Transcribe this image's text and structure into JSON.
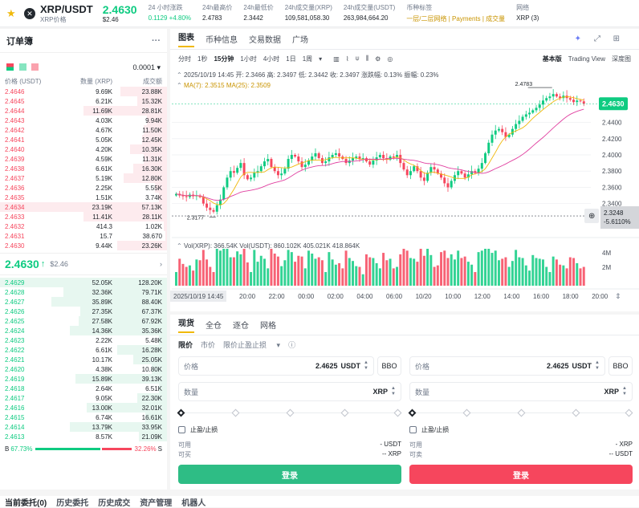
{
  "header": {
    "symbol": "XRP/USDT",
    "sub_label": "XRP价格",
    "price": "2.4630",
    "price_usd": "$2.46",
    "stats": [
      {
        "label": "24 小时涨跌",
        "value": "0.1129 +4.80%",
        "tone": "green"
      },
      {
        "label": "24h最高价",
        "value": "2.4783",
        "tone": ""
      },
      {
        "label": "24h最低价",
        "value": "2.3442",
        "tone": ""
      },
      {
        "label": "24h成交量(XRP)",
        "value": "109,581,058.30",
        "tone": ""
      },
      {
        "label": "24h成交量(USDT)",
        "value": "263,984,664.20",
        "tone": ""
      },
      {
        "label": "币种标签",
        "value": "一层/二层网络 | Payments | 成交量",
        "tone": "yellow"
      },
      {
        "label": "网络",
        "value": "XRP (3)",
        "tone": ""
      }
    ]
  },
  "orderbook": {
    "title": "订单簿",
    "tick": "0.0001",
    "columns": [
      "价格 (USDT)",
      "数量 (XRP)",
      "成交额"
    ],
    "asks": [
      {
        "price": "2.4646",
        "qty": "9.69K",
        "total": "23.88K",
        "depth": 0.28
      },
      {
        "price": "2.4645",
        "qty": "6.21K",
        "total": "15.32K",
        "depth": 0.18
      },
      {
        "price": "2.4644",
        "qty": "11.69K",
        "total": "28.81K",
        "depth": 0.5
      },
      {
        "price": "2.4643",
        "qty": "4.03K",
        "total": "9.94K",
        "depth": 0.12
      },
      {
        "price": "2.4642",
        "qty": "4.67K",
        "total": "11.50K",
        "depth": 0.14
      },
      {
        "price": "2.4641",
        "qty": "5.05K",
        "total": "12.45K",
        "depth": 0.15
      },
      {
        "price": "2.4640",
        "qty": "4.20K",
        "total": "10.35K",
        "depth": 0.22
      },
      {
        "price": "2.4639",
        "qty": "4.59K",
        "total": "11.31K",
        "depth": 0.14
      },
      {
        "price": "2.4638",
        "qty": "6.61K",
        "total": "16.30K",
        "depth": 0.2
      },
      {
        "price": "2.4637",
        "qty": "5.19K",
        "total": "12.80K",
        "depth": 0.26
      },
      {
        "price": "2.4636",
        "qty": "2.25K",
        "total": "5.55K",
        "depth": 0.07
      },
      {
        "price": "2.4635",
        "qty": "1.51K",
        "total": "3.74K",
        "depth": 0.05
      },
      {
        "price": "2.4634",
        "qty": "23.19K",
        "total": "57.13K",
        "depth": 1.0
      },
      {
        "price": "2.4633",
        "qty": "11.41K",
        "total": "28.11K",
        "depth": 0.5
      },
      {
        "price": "2.4632",
        "qty": "414.3",
        "total": "1.02K",
        "depth": 0.02
      },
      {
        "price": "2.4631",
        "qty": "15.7",
        "total": "38.670",
        "depth": 0.01
      },
      {
        "price": "2.4630",
        "qty": "9.44K",
        "total": "23.26K",
        "depth": 0.3
      }
    ],
    "mid_price": "2.4630",
    "mid_arrow": "↑",
    "mid_usd": "$2.46",
    "bids": [
      {
        "price": "2.4629",
        "qty": "52.05K",
        "total": "128.20K",
        "depth": 1.0
      },
      {
        "price": "2.4628",
        "qty": "32.36K",
        "total": "79.71K",
        "depth": 0.62
      },
      {
        "price": "2.4627",
        "qty": "35.89K",
        "total": "88.40K",
        "depth": 0.69
      },
      {
        "price": "2.4626",
        "qty": "27.35K",
        "total": "67.37K",
        "depth": 0.52
      },
      {
        "price": "2.4625",
        "qty": "27.58K",
        "total": "67.92K",
        "depth": 0.53
      },
      {
        "price": "2.4624",
        "qty": "14.36K",
        "total": "35.36K",
        "depth": 0.58
      },
      {
        "price": "2.4623",
        "qty": "2.22K",
        "total": "5.48K",
        "depth": 0.05
      },
      {
        "price": "2.4622",
        "qty": "6.61K",
        "total": "16.28K",
        "depth": 0.3
      },
      {
        "price": "2.4621",
        "qty": "10.17K",
        "total": "25.05K",
        "depth": 0.2
      },
      {
        "price": "2.4620",
        "qty": "4.38K",
        "total": "10.80K",
        "depth": 0.09
      },
      {
        "price": "2.4619",
        "qty": "15.89K",
        "total": "39.13K",
        "depth": 0.55
      },
      {
        "price": "2.4618",
        "qty": "2.64K",
        "total": "6.51K",
        "depth": 0.05
      },
      {
        "price": "2.4617",
        "qty": "9.05K",
        "total": "22.30K",
        "depth": 0.18
      },
      {
        "price": "2.4616",
        "qty": "13.00K",
        "total": "32.01K",
        "depth": 0.48
      },
      {
        "price": "2.4615",
        "qty": "6.74K",
        "total": "16.61K",
        "depth": 0.13
      },
      {
        "price": "2.4614",
        "qty": "13.79K",
        "total": "33.95K",
        "depth": 0.58
      },
      {
        "price": "2.4613",
        "qty": "8.57K",
        "total": "21.09K",
        "depth": 0.17
      }
    ],
    "buy_ratio": "67.73%",
    "sell_ratio": "32.26%",
    "buy_fraction": 0.6773,
    "buy_letter": "B",
    "sell_letter": "S"
  },
  "chart": {
    "tabs": [
      "图表",
      "币种信息",
      "交易数据",
      "广场"
    ],
    "intervals": [
      "分时",
      "1秒",
      "15分钟",
      "1小时",
      "4小时",
      "1日",
      "1周"
    ],
    "active_interval": "15分钟",
    "views": [
      "基本版",
      "Trading View",
      "深度图"
    ],
    "ohlc_line": "2025/10/19 14:45  开: 2.3466  高: 2.3497  低: 2.3442  收: 2.3497  涨跌幅: 0.13%  振幅: 0.23%",
    "ma_line": "MA(7): 2.3515  MA(25): 2.3509",
    "vol_line": "Vol(XRP): 366.54K  Vol(USDT): 860.102K  405.021K  418.864K",
    "high_marker": "2.4783",
    "low_marker": "2.3177",
    "current_label": "2.4630",
    "cursor_price": "2.3248",
    "cursor_pct": "-5.6110%",
    "price_ticks": [
      "2.4400",
      "2.4200",
      "2.4000",
      "2.3800",
      "2.3600",
      "2.3400"
    ],
    "vol_ticks": [
      "4M",
      "2M"
    ],
    "time_ticks": [
      "2025/10/19 14:45",
      "20:00",
      "22:00",
      "00:00",
      "02:00",
      "04:00",
      "06:00",
      "10/20",
      "10:00",
      "12:00",
      "14:00",
      "16:00",
      "18:00",
      "20:00"
    ],
    "colors": {
      "up": "#0ecb81",
      "down": "#f6465d",
      "ma7": "#f0b90b",
      "ma25": "#e040a0"
    }
  },
  "chart_data": {
    "type": "candlestick",
    "title": "XRP/USDT 15分钟",
    "ylim": [
      2.31,
      2.49
    ],
    "closes": [
      2.352,
      2.35,
      2.349,
      2.348,
      2.351,
      2.349,
      2.35,
      2.348,
      2.34,
      2.335,
      2.332,
      2.33,
      2.338,
      2.345,
      2.36,
      2.372,
      2.38,
      2.378,
      2.384,
      2.39,
      2.375,
      2.37,
      2.372,
      2.378,
      2.38,
      2.386,
      2.392,
      2.395,
      2.385,
      2.38,
      2.375,
      2.377,
      2.383,
      2.395,
      2.4,
      2.398,
      2.392,
      2.385,
      2.388,
      2.393,
      2.398,
      2.402,
      2.396,
      2.39,
      2.392,
      2.397,
      2.4,
      2.402,
      2.398,
      2.395,
      2.39,
      2.393,
      2.396,
      2.398,
      2.395,
      2.396,
      2.392,
      2.388,
      2.393,
      2.397,
      2.4,
      2.396,
      2.394,
      2.398,
      2.397,
      2.4,
      2.39,
      2.382,
      2.375,
      2.38,
      2.386,
      2.38,
      2.372,
      2.368,
      2.378,
      2.385,
      2.382,
      2.377,
      2.372,
      2.365,
      2.36,
      2.368,
      2.375,
      2.38,
      2.377,
      2.372,
      2.376,
      2.38,
      2.378,
      2.383,
      2.39,
      2.402,
      2.415,
      2.425,
      2.43,
      2.432,
      2.428,
      2.422,
      2.425,
      2.432,
      2.438,
      2.442,
      2.447,
      2.45,
      2.452,
      2.455,
      2.458,
      2.462,
      2.467,
      2.47,
      2.472,
      2.475,
      2.472,
      2.47,
      2.473,
      2.47,
      2.468,
      2.465,
      2.467,
      2.466,
      2.463
    ]
  },
  "trade": {
    "tabs": [
      "现货",
      "全仓",
      "逐仓",
      "网格"
    ],
    "order_types": [
      "限价",
      "市价",
      "限价止盈止损"
    ],
    "buy": {
      "price_label": "价格",
      "price": "2.4625",
      "unit": "USDT",
      "qty_label": "数量",
      "qty_unit": "XRP",
      "bbo": "BBO",
      "tpsl": "止盈/止损",
      "avail_label": "可用",
      "avail": "- USDT",
      "buyable_label": "可买",
      "buyable": "-- XRP",
      "button": "登录"
    },
    "sell": {
      "price_label": "价格",
      "price": "2.4625",
      "unit": "USDT",
      "qty_label": "数量",
      "qty_unit": "XRP",
      "bbo": "BBO",
      "tpsl": "止盈/止损",
      "avail_label": "可用",
      "avail": "- XRP",
      "buyable_label": "可卖",
      "buyable": "-- USDT",
      "button": "登录"
    }
  },
  "bottom_tabs": [
    "当前委托(0)",
    "历史委托",
    "历史成交",
    "资产管理",
    "机器人"
  ]
}
